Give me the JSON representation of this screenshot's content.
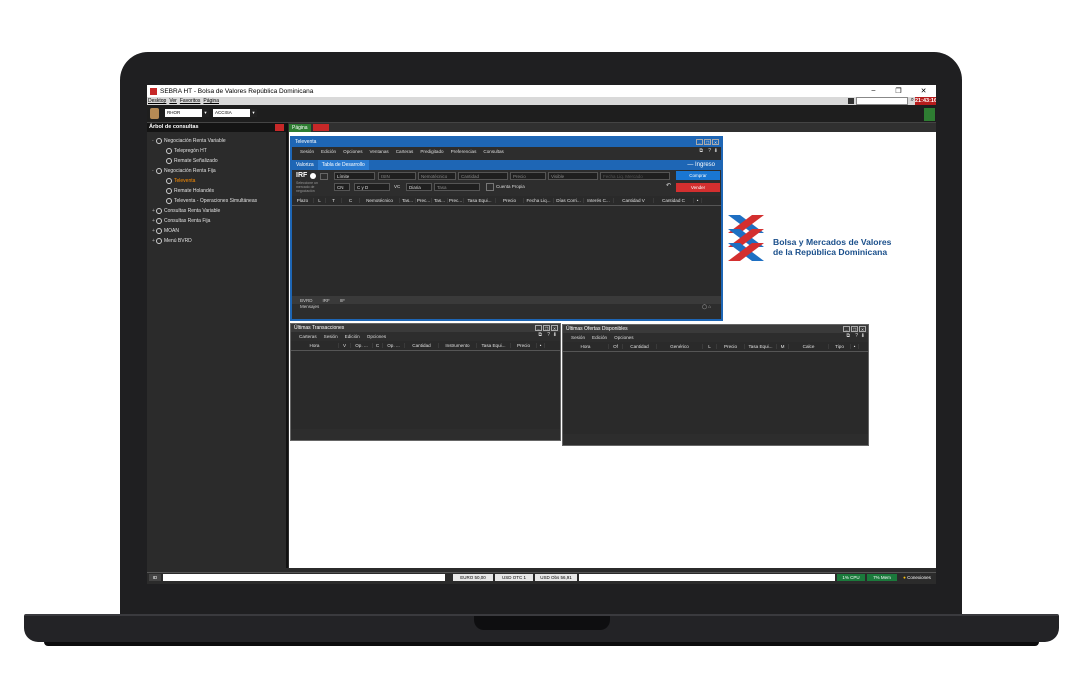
{
  "window": {
    "title": "SEBRA HT - Bolsa de Valores República Dominicana",
    "min": "–",
    "max": "❐",
    "close": "✕"
  },
  "menu": {
    "items": [
      "Desktop",
      "Ver",
      "Favoritos",
      "Página"
    ],
    "clock": "21:43:16"
  },
  "toolbar": {
    "select1": "RHOR",
    "select2": "ACCISA"
  },
  "sidebar": {
    "title": "Árbol de consultas",
    "items": [
      {
        "label": "Negociación Renta Variable"
      },
      {
        "label": "Telepregón HT"
      },
      {
        "label": "Remate Señalizado"
      },
      {
        "label": "Negociación Renta Fija"
      },
      {
        "label": "Televenta"
      },
      {
        "label": "Remate Holandés"
      },
      {
        "label": "Televenta - Operaciones Simultáneas"
      },
      {
        "label": "Consultas Renta Variable"
      },
      {
        "label": "Consultas Renta Fija"
      },
      {
        "label": "MOAN"
      },
      {
        "label": "Menú BVRD"
      }
    ]
  },
  "content": {
    "page_tab": "Página"
  },
  "televenta": {
    "title": "Televenta",
    "menu": [
      "Sesión",
      "Edición",
      "Opciones",
      "Ventanas",
      "Carteras",
      "Predigitado",
      "Preferencias",
      "Consultas"
    ],
    "tabs": [
      "Valoriza",
      "Tabla de Desarrollo"
    ],
    "ingreso": "Ingreso",
    "irf": "IRF",
    "irf_hint": "Seleccione un mercado de negociación",
    "order_type": "Límite",
    "isin_ph": "ISIN",
    "nemo_ph": "Nemotécnico",
    "cantidad_ph": "Cantidad",
    "precio_ph": "Precio",
    "visible_ph": "Visible",
    "fecha_ph": "Fecha Liq. Mercado",
    "mercado": "CN",
    "cyd": "C y D",
    "vc": "VC",
    "plazo": "Diaria",
    "tasa_ph": "Tasa",
    "cuenta": "Cuenta Propia",
    "comprar": "Comprar",
    "vender": "Vender",
    "columns": [
      "Plazo",
      "L",
      "T",
      "C",
      "Nemotécnico",
      "Tas...",
      "Prec...",
      "Tas...",
      "Prec...",
      "Tasa Equi...",
      "Precio",
      "Fecha Liq...",
      "Días Corri...",
      "Interés C...",
      "Cantidad V",
      "Cantidad C"
    ],
    "bottom_tabs": [
      "BVRD",
      "IRF",
      "IIF"
    ],
    "mensajes": "Mensajes"
  },
  "ultimas_transacciones": {
    "title": "Últimas Transacciones",
    "menu": [
      "Carteras",
      "Sesión",
      "Edición",
      "Opciones"
    ],
    "columns": [
      "Hora",
      "V",
      "Op. ...",
      "C",
      "Op. ...",
      "Cantidad",
      "Instrumento",
      "Tasa Equi...",
      "Precio"
    ]
  },
  "ultimas_ofertas": {
    "title": "Últimas Ofertas Disponibles",
    "menu": [
      "Sesión",
      "Edición",
      "Opciones"
    ],
    "columns": [
      "Hora",
      "Of",
      "Cantidad",
      "Genérico",
      "L",
      "Precio",
      "Tasa Equi...",
      "M",
      "Calce",
      "Tipo"
    ]
  },
  "logo": {
    "line1": "Bolsa y Mercados de Valores",
    "line2": "de la República Dominicana"
  },
  "status": {
    "id": "ID",
    "euro": "EURO 50,00",
    "usd_otc": "USD OTC 1",
    "usd_obs": "USD Obs 56,91",
    "cpu": "1% CPU",
    "mem": "7% Mem",
    "conexiones": "Conexiones"
  },
  "colors": {
    "accent_blue": "#1e66b5",
    "buy": "#1976d2",
    "sell": "#d32f2f",
    "clock_bg": "#b71c1c",
    "status_green": "#1b7a3c"
  }
}
